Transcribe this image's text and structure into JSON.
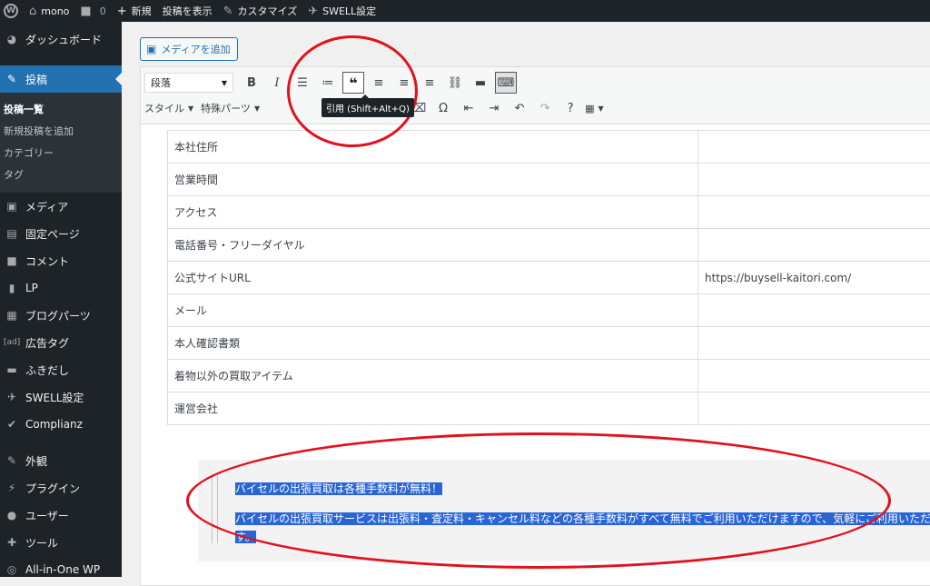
{
  "adminbar": {
    "site_name": "mono",
    "comment_count": "0",
    "new_label": "新規",
    "view_post": "投稿を表示",
    "customize": "カスタマイズ",
    "swell_settings": "SWELL設定"
  },
  "sidebar": {
    "dashboard": "ダッシュボード",
    "posts": "投稿",
    "submenu": [
      "投稿一覧",
      "新規投稿を追加",
      "カテゴリー",
      "タグ"
    ],
    "items": [
      "メディア",
      "固定ページ",
      "コメント",
      "LP",
      "ブログパーツ",
      "広告タグ",
      "ふきだし",
      "SWELL設定",
      "Complianz"
    ],
    "items2": [
      "外観",
      "プラグイン",
      "ユーザー",
      "ツール",
      "All-in-One WP"
    ],
    "ad_prefix": "[ad]"
  },
  "editor": {
    "add_media": "メディアを追加",
    "format_select": "段落",
    "style_label": "スタイル",
    "special_parts_label": "特殊パーツ",
    "tooltip": "引用 (Shift+Alt+Q)"
  },
  "table": {
    "rows": [
      [
        "本社住所",
        ""
      ],
      [
        "営業時間",
        ""
      ],
      [
        "アクセス",
        ""
      ],
      [
        "電話番号・フリーダイヤル",
        ""
      ],
      [
        "公式サイトURL",
        "https://buysell-kaitori.com/"
      ],
      [
        "メール",
        ""
      ],
      [
        "本人確認書類",
        ""
      ],
      [
        "着物以外の買取アイテム",
        ""
      ],
      [
        "運営会社",
        ""
      ]
    ]
  },
  "quote": {
    "line1": "バイセルの出張買取は各種手数料が無料！",
    "line2": "バイセルの出張買取サービスは出張料・査定料・キャンセル料などの各種手数料がすべて無料でご利用いただけますので、気軽にご利用いただけま",
    "line3": "す。"
  },
  "colors": {
    "admin_bg": "#1d2327",
    "accent": "#2271b1",
    "selection": "#2a65d6",
    "annotation": "#e3111c"
  }
}
